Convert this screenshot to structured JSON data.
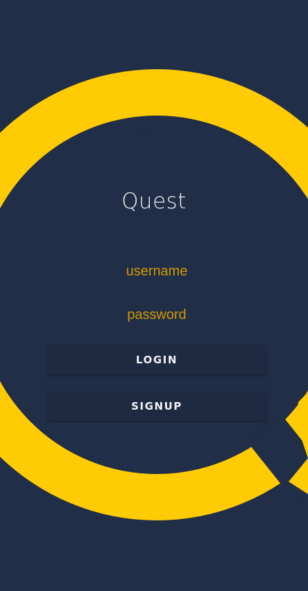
{
  "theme": {
    "background": "#212e47",
    "accent": "#ffcb05",
    "field_text": "#d09a00",
    "button_background": "#1e2a42",
    "text_light": "#eef0f4"
  },
  "brand": {
    "logo_icon": "q-ring-logo-icon",
    "title": "Quest"
  },
  "form": {
    "username_placeholder": "username",
    "password_placeholder": "password",
    "login_label": "LOGIN",
    "signup_label": "SIGNUP"
  }
}
